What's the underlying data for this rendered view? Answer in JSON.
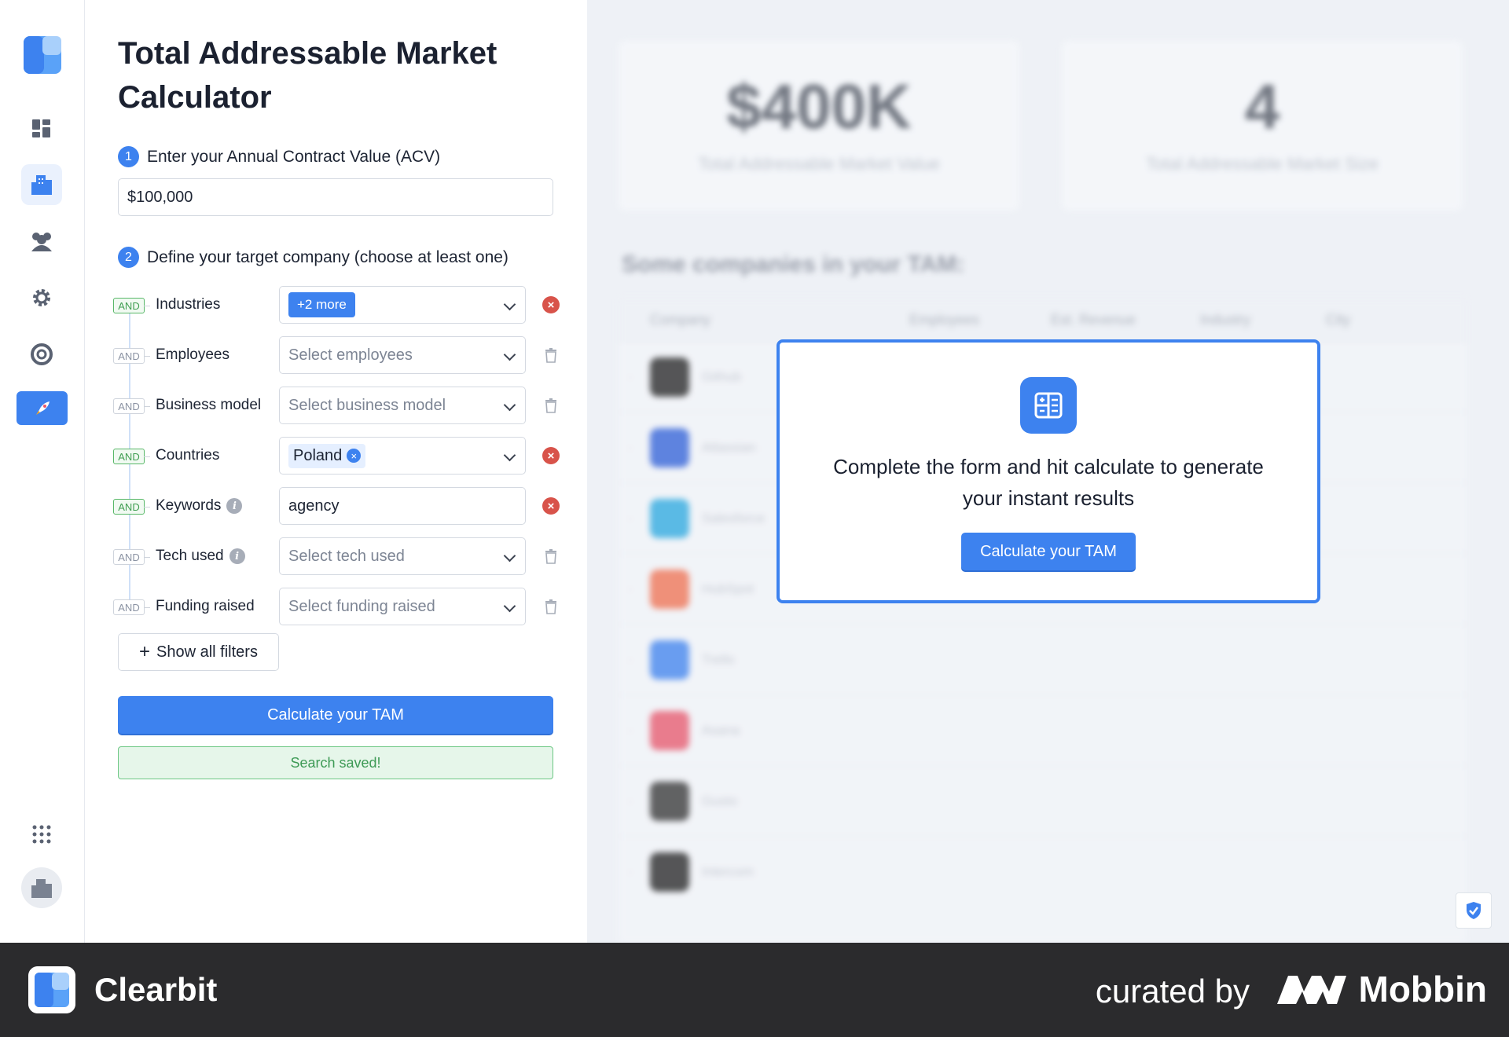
{
  "panel": {
    "title": "Total Addressable Market Calculator",
    "step1_num": "1",
    "step1_label": "Enter your Annual Contract Value (ACV)",
    "acv_value": "$100,000",
    "step2_num": "2",
    "step2_label": "Define your target company (choose at least one)",
    "and_label": "AND",
    "filters": {
      "industries": {
        "label": "Industries",
        "pill": "+2 more"
      },
      "employees": {
        "label": "Employees",
        "placeholder": "Select employees"
      },
      "business_model": {
        "label": "Business model",
        "placeholder": "Select business model"
      },
      "countries": {
        "label": "Countries",
        "tag": "Poland"
      },
      "keywords": {
        "label": "Keywords",
        "value": "agency"
      },
      "tech_used": {
        "label": "Tech used",
        "placeholder": "Select tech used"
      },
      "funding_raised": {
        "label": "Funding raised",
        "placeholder": "Select funding raised"
      }
    },
    "show_all": "Show all filters",
    "calculate": "Calculate your TAM",
    "saved": "Search saved!"
  },
  "results": {
    "tam_value": "$400K",
    "tam_value_label": "Total Addressable Market Value",
    "tam_size": "4",
    "tam_size_label": "Total Addressable Market Size",
    "companies_title": "Some companies in your TAM:",
    "columns": [
      "Company",
      "Employees",
      "Est. Revenue",
      "Industry",
      "City"
    ],
    "companies": [
      {
        "name": "Github",
        "color": "#222222"
      },
      {
        "name": "Atlassian",
        "color": "#2e5fd8"
      },
      {
        "name": "Salesforce",
        "color": "#29a8e0"
      },
      {
        "name": "HubSpot",
        "color": "#f07050"
      },
      {
        "name": "Trello",
        "color": "#3d82ef"
      },
      {
        "name": "Asana",
        "color": "#e8566b"
      },
      {
        "name": "Gusto",
        "color": "#333333"
      },
      {
        "name": "Intercom",
        "color": "#222222"
      }
    ]
  },
  "modal": {
    "message": "Complete the form and hit calculate to generate your instant results",
    "button": "Calculate your TAM"
  },
  "footer": {
    "brand": "Clearbit",
    "curated": "curated by",
    "mobbin": "Mobbin"
  },
  "colors": {
    "accent": "#3d82ef",
    "danger": "#d8534a",
    "success": "#3d9a55"
  }
}
